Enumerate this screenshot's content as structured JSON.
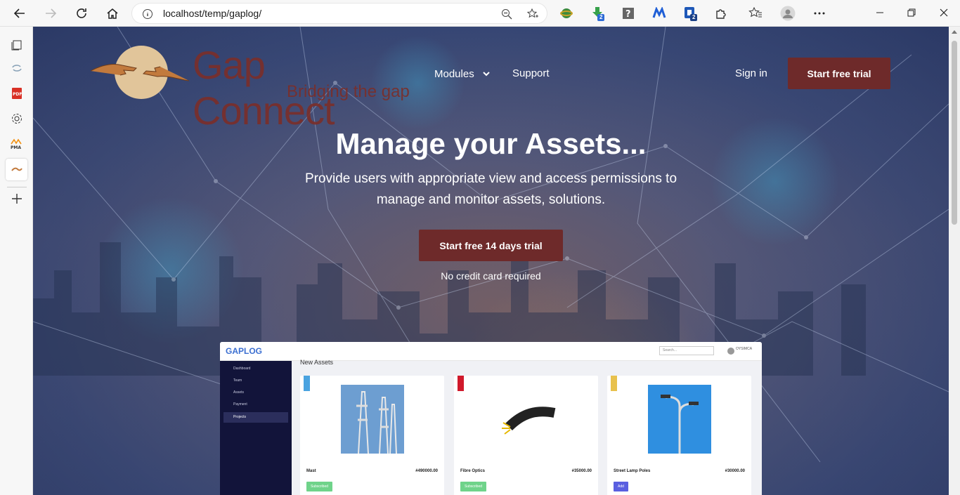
{
  "browser": {
    "url": "localhost/temp/gaplog/",
    "extensions": [
      "globe-extension-icon",
      "download-extension-icon",
      "help-extension-icon",
      "m-extension-icon",
      "password-extension-icon"
    ],
    "extension_badges": {
      "download": "2",
      "password": "2"
    }
  },
  "header": {
    "logo_title": "Gap Connect",
    "logo_tagline": "Bridging the gap",
    "nav_modules": "Modules",
    "nav_support": "Support",
    "signin": "Sign in",
    "trial_button": "Start free trial"
  },
  "hero": {
    "title": "Manage your Assets...",
    "subtitle": "Provide users with appropriate view and access permissions to manage and monitor assets, solutions.",
    "button": "Start free 14 days trial",
    "note": "No credit card required"
  },
  "preview": {
    "logo": "GAPLOG",
    "search_placeholder": "Search...",
    "user": "OYSIMCA",
    "heading": "New Assets",
    "nav": [
      "Dashboard",
      "Team",
      "Assets",
      "Payment",
      "Projects"
    ],
    "cards": [
      {
        "name": "Mast",
        "price": "#490000.00",
        "button": "Subscribed",
        "button_color": "#6fd38a",
        "ribbon_color": "#4aa3e0"
      },
      {
        "name": "Fibre Optics",
        "price": "#35000.00",
        "button": "Subscribed",
        "button_color": "#6fd38a",
        "ribbon_color": "#d0192b"
      },
      {
        "name": "Street Lamp Poles",
        "price": "#30000.00",
        "button": "Add",
        "button_color": "#5a5fe0",
        "ribbon_color": "#e8c14d"
      }
    ]
  },
  "colors": {
    "brand_maroon": "#6e2a2a",
    "logo_text": "#7b2e29"
  }
}
